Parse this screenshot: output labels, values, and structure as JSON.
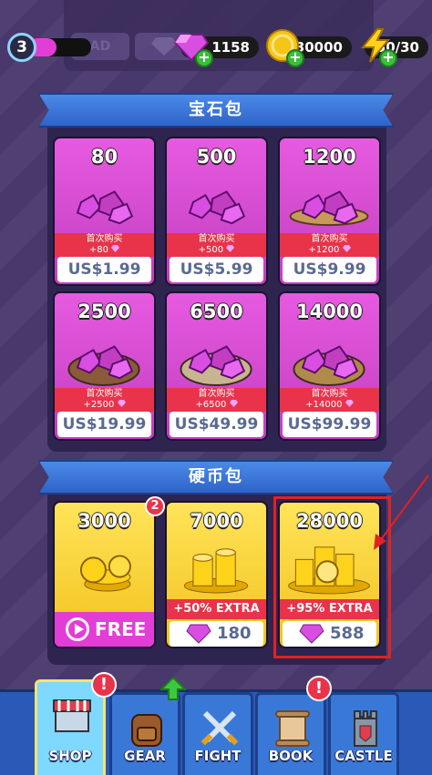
{
  "player": {
    "level": "3",
    "xp_fraction": 0.45
  },
  "ghost_buttons": {
    "ad_label": "AD"
  },
  "currencies": {
    "gems": "1158",
    "coins": "30000",
    "energy": "50/30"
  },
  "gem_section": {
    "title": "宝石包",
    "first_purchase_label": "首次购买",
    "packs": [
      {
        "amount": "80",
        "bonus": "+80",
        "price": "US$1.99"
      },
      {
        "amount": "500",
        "bonus": "+500",
        "price": "US$5.99"
      },
      {
        "amount": "1200",
        "bonus": "+1200",
        "price": "US$9.99"
      },
      {
        "amount": "2500",
        "bonus": "+2500",
        "price": "US$19.99"
      },
      {
        "amount": "6500",
        "bonus": "+6500",
        "price": "US$49.99"
      },
      {
        "amount": "14000",
        "bonus": "+14000",
        "price": "US$99.99"
      }
    ]
  },
  "coin_section": {
    "title": "硬币包",
    "packs": [
      {
        "amount": "3000",
        "badge": "2",
        "action": "FREE"
      },
      {
        "amount": "7000",
        "extra": "+50% EXTRA",
        "gem_cost": "180"
      },
      {
        "amount": "28000",
        "extra": "+95% EXTRA",
        "gem_cost": "588"
      }
    ]
  },
  "nav": {
    "tabs": [
      {
        "label": "SHOP",
        "alert": "!"
      },
      {
        "label": "GEAR"
      },
      {
        "label": "FIGHT"
      },
      {
        "label": "BOOK",
        "alert": "!"
      },
      {
        "label": "CASTLE"
      }
    ]
  },
  "colors": {
    "gem_card": "#e65ae0",
    "coin_card": "#f2c21c",
    "price_red": "#e8334a",
    "nav_blue": "#3a78d8"
  }
}
